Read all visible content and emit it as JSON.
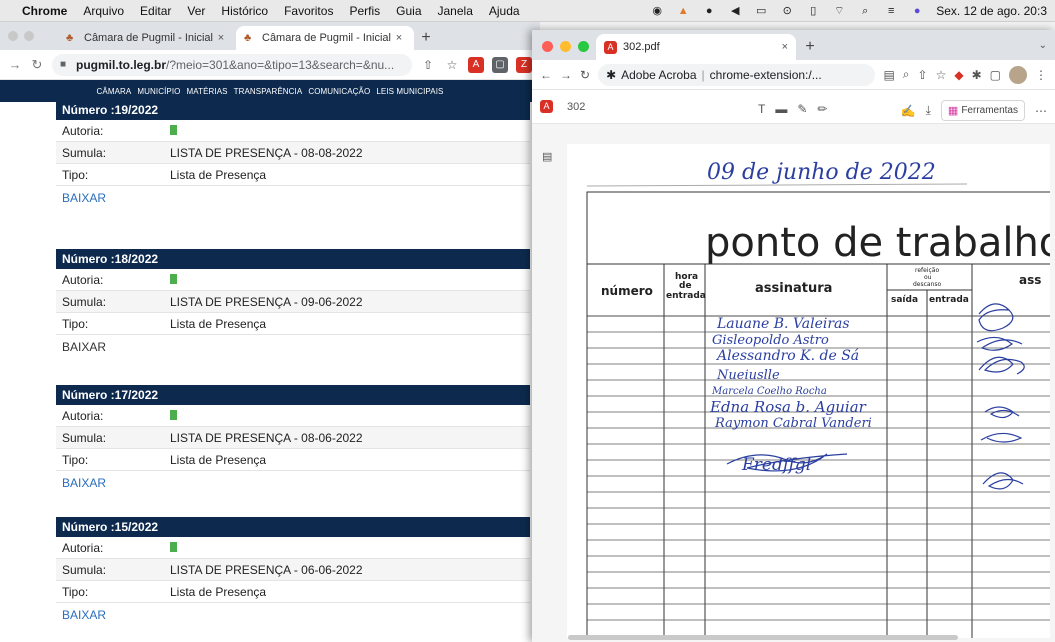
{
  "menubar": {
    "items": [
      "Chrome",
      "Arquivo",
      "Editar",
      "Ver",
      "Histórico",
      "Favoritos",
      "Perfis",
      "Guia",
      "Janela",
      "Ajuda"
    ],
    "datetime": "Sex. 12 de ago. 20:3"
  },
  "left_window": {
    "tabs": [
      {
        "label": "Câmara de Pugmil - Inicial"
      },
      {
        "label": "Câmara de Pugmil - Inicial"
      }
    ],
    "url_host": "pugmil.to.leg.br",
    "url_path": "/?meio=301&ano=&tipo=13&search=&nu...",
    "site_nav": [
      "CÂMARA",
      "MUNICÍPIO",
      "MATÉRIAS",
      "TRANSPARÊNCIA",
      "COMUNICAÇÃO",
      "LEIS MUNICIPAIS"
    ],
    "field_labels": {
      "autoria": "Autoria:",
      "sumula": "Sumula:",
      "tipo": "Tipo:"
    },
    "records": [
      {
        "numero": "Número :19/2022",
        "sumula": "LISTA DE PRESENÇA - 08-08-2022",
        "tipo": "Lista de Presença",
        "baixar": "BAIXAR"
      },
      {
        "numero": "Número :18/2022",
        "sumula": "LISTA DE PRESENÇA - 09-06-2022",
        "tipo": "Lista de Presença",
        "baixar": "BAIXAR"
      },
      {
        "numero": "Número :17/2022",
        "sumula": "LISTA DE PRESENÇA - 08-06-2022",
        "tipo": "Lista de Presença",
        "baixar": "BAIXAR"
      },
      {
        "numero": "Número :15/2022",
        "sumula": "LISTA DE PRESENÇA - 06-06-2022",
        "tipo": "Lista de Presença",
        "baixar": "BAIXAR"
      }
    ]
  },
  "right_window": {
    "tab_label": "302.pdf",
    "omni_site": "Adobe Acroba",
    "omni_url": "chrome-extension:/...",
    "doc_name": "302",
    "tools_label": "Ferramentas",
    "document": {
      "handwritten_date": "09 de junho de 2022",
      "title": "ponto de trabalho",
      "col_numero": "número",
      "col_hora": "hora",
      "col_de": "de",
      "col_entrada": "entrada",
      "col_assinatura": "assinatura",
      "col_refeicao": "refeição",
      "col_ou": "ou",
      "col_descanso": "descanso",
      "col_saida": "saída",
      "col_entrada2": "entrada",
      "col_ass": "ass",
      "signatures": [
        "Lauane B. Valeiras",
        "Gisleopoldo Astro",
        "Alessandro K. de Sá",
        "Nueiuslle",
        "Marcela Coelho Rocha",
        "Edna Rosa b. Aguiar",
        "Raymon Cabral Vanderi",
        "Fredffgl"
      ]
    }
  }
}
